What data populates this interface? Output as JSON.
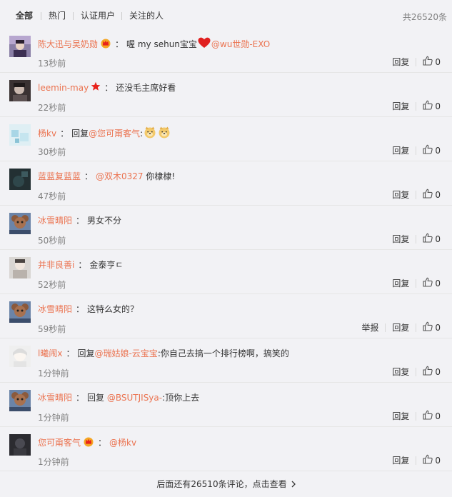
{
  "filters": {
    "tabs": [
      {
        "label": "全部"
      },
      {
        "label": "热门"
      },
      {
        "label": "认证用户"
      },
      {
        "label": "关注的人"
      }
    ],
    "total": "共26520条"
  },
  "actions": {
    "reply": "回复",
    "report": "举报"
  },
  "comments": [
    {
      "user": "陈大迅与吴奶勋",
      "badge": "crown-icon",
      "parts": [
        {
          "t": "text",
          "v": "喔 my sehun宝宝"
        },
        {
          "t": "icon",
          "v": "heart-icon"
        },
        {
          "t": "mention",
          "v": "@wu世勋-EXO"
        }
      ],
      "time": "13秒前",
      "likes": "0"
    },
    {
      "user": "leemin-may",
      "badge": "star-icon",
      "parts": [
        {
          "t": "text",
          "v": "还没毛主席好看"
        }
      ],
      "time": "22秒前",
      "likes": "0"
    },
    {
      "user": "杨kv",
      "badge": "",
      "parts": [
        {
          "t": "text",
          "v": "回复"
        },
        {
          "t": "mention",
          "v": "@您可甭客气"
        },
        {
          "t": "text",
          "v": ":"
        },
        {
          "t": "icon",
          "v": "doge-icon"
        },
        {
          "t": "icon",
          "v": "doge-icon"
        }
      ],
      "time": "30秒前",
      "likes": "0"
    },
    {
      "user": "蓝蓝复蓝蓝",
      "badge": "",
      "parts": [
        {
          "t": "mention",
          "v": "@双木0327"
        },
        {
          "t": "text",
          "v": " 你棣棣!"
        }
      ],
      "time": "47秒前",
      "likes": "0"
    },
    {
      "user": "冰雪晴阳",
      "badge": "",
      "parts": [
        {
          "t": "text",
          "v": "男女不分"
        }
      ],
      "time": "50秒前",
      "likes": "0"
    },
    {
      "user": "并非良善i",
      "badge": "",
      "parts": [
        {
          "t": "text",
          "v": "金泰亨ㄷ"
        }
      ],
      "time": "52秒前",
      "likes": "0"
    },
    {
      "user": "冰雪晴阳",
      "badge": "",
      "parts": [
        {
          "t": "text",
          "v": "这特么女的？"
        }
      ],
      "time": "59秒前",
      "likes": "0",
      "report": true
    },
    {
      "user": "l曦闹x",
      "badge": "",
      "parts": [
        {
          "t": "text",
          "v": "回复"
        },
        {
          "t": "mention",
          "v": "@瑞姑娘-云宝宝"
        },
        {
          "t": "text",
          "v": ":你自己去搞一个排行榜啊，搞笑的"
        }
      ],
      "time": "1分钟前",
      "likes": "0"
    },
    {
      "user": "冰雪晴阳",
      "badge": "",
      "parts": [
        {
          "t": "text",
          "v": "回复 "
        },
        {
          "t": "mention",
          "v": "@BSUTJISya-"
        },
        {
          "t": "text",
          "v": ":顶你上去"
        }
      ],
      "time": "1分钟前",
      "likes": "0"
    },
    {
      "user": "您可甭客气",
      "badge": "crown-icon",
      "parts": [
        {
          "t": "mention",
          "v": "@杨kv"
        }
      ],
      "time": "1分钟前",
      "likes": "0"
    }
  ],
  "avatars": [
    "avatar-1",
    "avatar-2",
    "avatar-3",
    "avatar-4",
    "avatar-5",
    "avatar-6",
    "avatar-7",
    "avatar-8",
    "avatar-9",
    "avatar-10"
  ],
  "colors": {
    "accent": "#eb7350",
    "muted": "#808080",
    "background": "#f2f2f5"
  },
  "footer": {
    "more": "后面还有26510条评论，点击查看"
  }
}
